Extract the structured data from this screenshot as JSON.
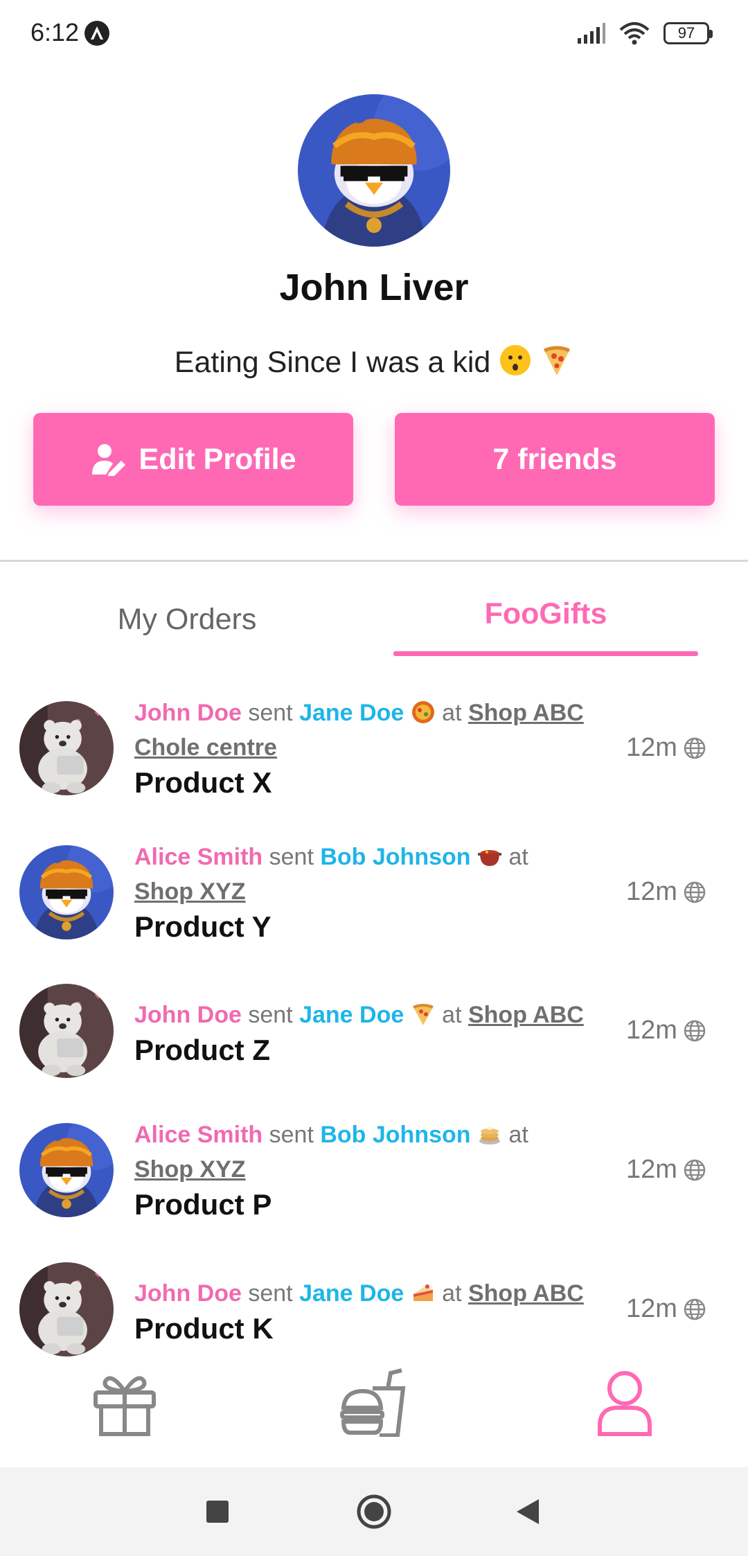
{
  "status_bar": {
    "time": "6:12",
    "battery": "97"
  },
  "profile": {
    "name": "John Liver",
    "bio": "Eating Since I was a kid",
    "bio_emojis": [
      "kissing-face-emoji",
      "pizza-emoji"
    ],
    "edit_button_label": "Edit Profile",
    "friends_button_label": "7 friends"
  },
  "tabs": {
    "my_orders": "My Orders",
    "foogifts": "FooGifts",
    "active": "FooGifts"
  },
  "feed": [
    {
      "sender": "John Doe",
      "sent_word": "sent",
      "recipient": "Jane Doe",
      "emoji": "paella-emoji",
      "at_word": "at",
      "shop": "Shop ABC Chole centre",
      "product": "Product X",
      "time": "12m",
      "avatar": "bear-avatar"
    },
    {
      "sender": "Alice Smith",
      "sent_word": "sent",
      "recipient": "Bob Johnson",
      "emoji": "pot-of-food-emoji",
      "at_word": "at",
      "shop": "Shop XYZ",
      "product": "Product Y",
      "time": "12m",
      "avatar": "penguin-avatar"
    },
    {
      "sender": "John Doe",
      "sent_word": "sent",
      "recipient": "Jane Doe",
      "emoji": "pizza-emoji",
      "at_word": "at",
      "shop": "Shop ABC",
      "product": "Product Z",
      "time": "12m",
      "avatar": "bear-avatar"
    },
    {
      "sender": "Alice Smith",
      "sent_word": "sent",
      "recipient": "Bob Johnson",
      "emoji": "pancakes-emoji",
      "at_word": "at",
      "shop": "Shop XYZ",
      "product": "Product P",
      "time": "12m",
      "avatar": "penguin-avatar"
    },
    {
      "sender": "John Doe",
      "sent_word": "sent",
      "recipient": "Jane Doe",
      "emoji": "cake-emoji",
      "at_word": "at",
      "shop": "Shop ABC",
      "product": "Product K",
      "time": "12m",
      "avatar": "bear-avatar"
    }
  ],
  "bottom_nav": {
    "items": [
      "gift-icon",
      "food-icon",
      "profile-icon"
    ],
    "active": "profile-icon"
  },
  "colors": {
    "accent_pink": "#ff69b4",
    "name_pink": "#f06ab0",
    "name_blue": "#1fb5e8"
  }
}
